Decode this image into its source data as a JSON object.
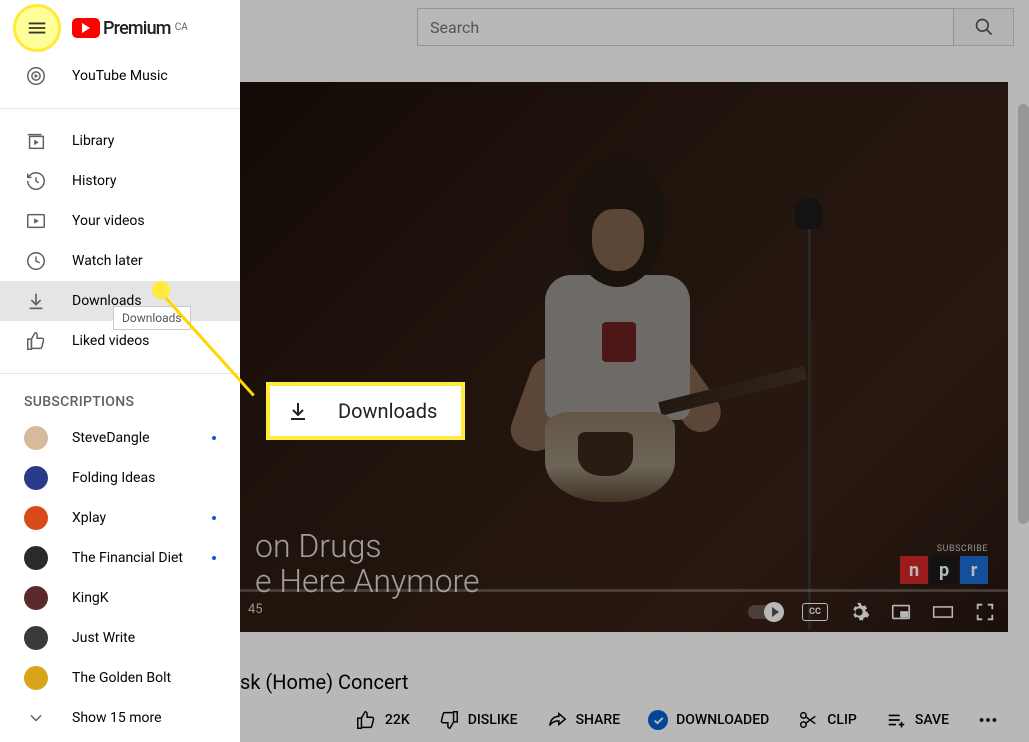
{
  "header": {
    "premium_label": "Premium",
    "country": "CA",
    "search_placeholder": "Search"
  },
  "sidebar": {
    "ytmusic": "YouTube Music",
    "library": "Library",
    "history": "History",
    "your_videos": "Your videos",
    "watch_later": "Watch later",
    "downloads": "Downloads",
    "liked": "Liked videos",
    "subscriptions_header": "SUBSCRIPTIONS",
    "channels": [
      {
        "name": "SteveDangle",
        "dot": true,
        "color": "#d9b99b"
      },
      {
        "name": "Folding Ideas",
        "dot": false,
        "color": "#2a3a8a"
      },
      {
        "name": "Xplay",
        "dot": true,
        "color": "#d94a1a"
      },
      {
        "name": "The Financial Diet",
        "dot": true,
        "color": "#2a2a2a"
      },
      {
        "name": "KingK",
        "dot": false,
        "color": "#5a2a2a"
      },
      {
        "name": "Just Write",
        "dot": false,
        "color": "#3a3a3a"
      },
      {
        "name": "The Golden Bolt",
        "dot": false,
        "color": "#d9a518"
      }
    ],
    "show_more": "Show 15 more"
  },
  "tooltip": "Downloads",
  "callout": "Downloads",
  "video": {
    "line1": "on Drugs",
    "line2": "e Here Anymore",
    "time": "45",
    "subscribe": "SUBSCRIBE",
    "npr": [
      "n",
      "p",
      "r"
    ],
    "title_partial": "sk (Home) Concert",
    "cc": "CC"
  },
  "actions": {
    "like_count": "22K",
    "dislike": "DISLIKE",
    "share": "SHARE",
    "downloaded": "DOWNLOADED",
    "clip": "CLIP",
    "save": "SAVE"
  }
}
